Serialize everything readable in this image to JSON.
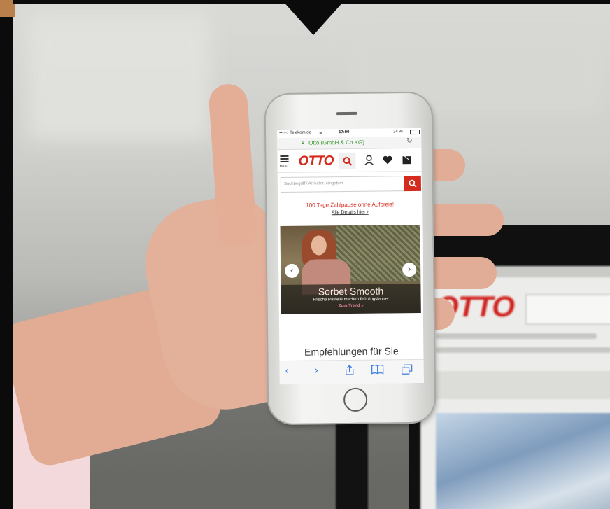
{
  "colors": {
    "otto_red": "#d52b1e",
    "secure_green": "#3a9a2f",
    "safari_blue": "#3b7be0"
  },
  "phone": {
    "status": {
      "carrier": "•••○○ Telekom.de",
      "wifi_icon": "wifi-icon",
      "time": "17:00",
      "battery": "24 %"
    },
    "url_bar": {
      "lock_icon": "lock-icon",
      "text": "Otto (GmbH & Co KG)",
      "reload_icon": "reload-icon"
    },
    "header": {
      "menu_label": "Menü",
      "logo": "OTTO",
      "icons": [
        "search-icon",
        "user-icon",
        "heart-icon",
        "cart-icon"
      ]
    },
    "search": {
      "placeholder": "Suchbegriff / Artikelnr. eingeben",
      "button_icon": "search-icon"
    },
    "promo": {
      "headline": "100 Tage Zahlpause ohne Aufpreis!",
      "link": "Alle Details hier ›"
    },
    "banner": {
      "title": "Sorbet Smooth",
      "subtitle": "Frische Pastells machen Frühlingslaune!",
      "cta": "Zum Trend »",
      "prev": "‹",
      "next": "›"
    },
    "recommendations": {
      "title": "Empfehlungen für Sie"
    },
    "toolbar": {
      "back": "‹",
      "forward": "›",
      "share_icon": "share-icon",
      "bookmarks_icon": "bookmarks-icon",
      "tabs_icon": "tabs-icon"
    }
  },
  "monitor": {
    "logo": "OTTO"
  }
}
